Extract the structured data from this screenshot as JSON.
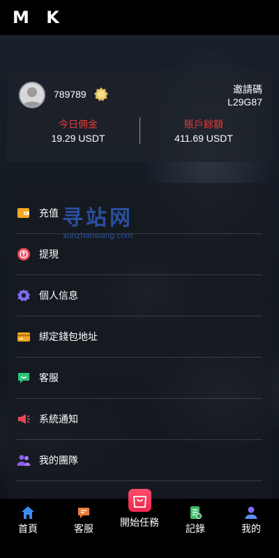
{
  "header": {
    "logo": "M K"
  },
  "profile": {
    "username": "789789",
    "invite_label": "邀請碼",
    "invite_code": "L29G87",
    "today_commission_label": "今日佣金",
    "today_commission_value": "19.29 USDT",
    "balance_label": "賬戶餘額",
    "balance_value": "411.69 USDT",
    "accent_color": "#e03a3a"
  },
  "watermark": {
    "line1": "寻站网",
    "line2": "xunzhanwang.com"
  },
  "menu": {
    "items": [
      {
        "label": "充值",
        "icon": "wallet-icon",
        "color": "#f5a623"
      },
      {
        "label": "提現",
        "icon": "withdraw-icon",
        "color": "#e8455a"
      },
      {
        "label": "個人信息",
        "icon": "gear-icon",
        "color": "#7b6cf0"
      },
      {
        "label": "綁定錢包地址",
        "icon": "card-icon",
        "color": "#f5a623"
      },
      {
        "label": "客服",
        "icon": "chat-icon",
        "color": "#2ec27e"
      },
      {
        "label": "系統通知",
        "icon": "megaphone-icon",
        "color": "#e8455a"
      },
      {
        "label": "我的團隊",
        "icon": "team-icon",
        "color": "#8e5cf0"
      }
    ]
  },
  "bottom_nav": {
    "home": "首頁",
    "service": "客服",
    "start_task": "開始任務",
    "records": "記錄",
    "mine": "我的"
  }
}
